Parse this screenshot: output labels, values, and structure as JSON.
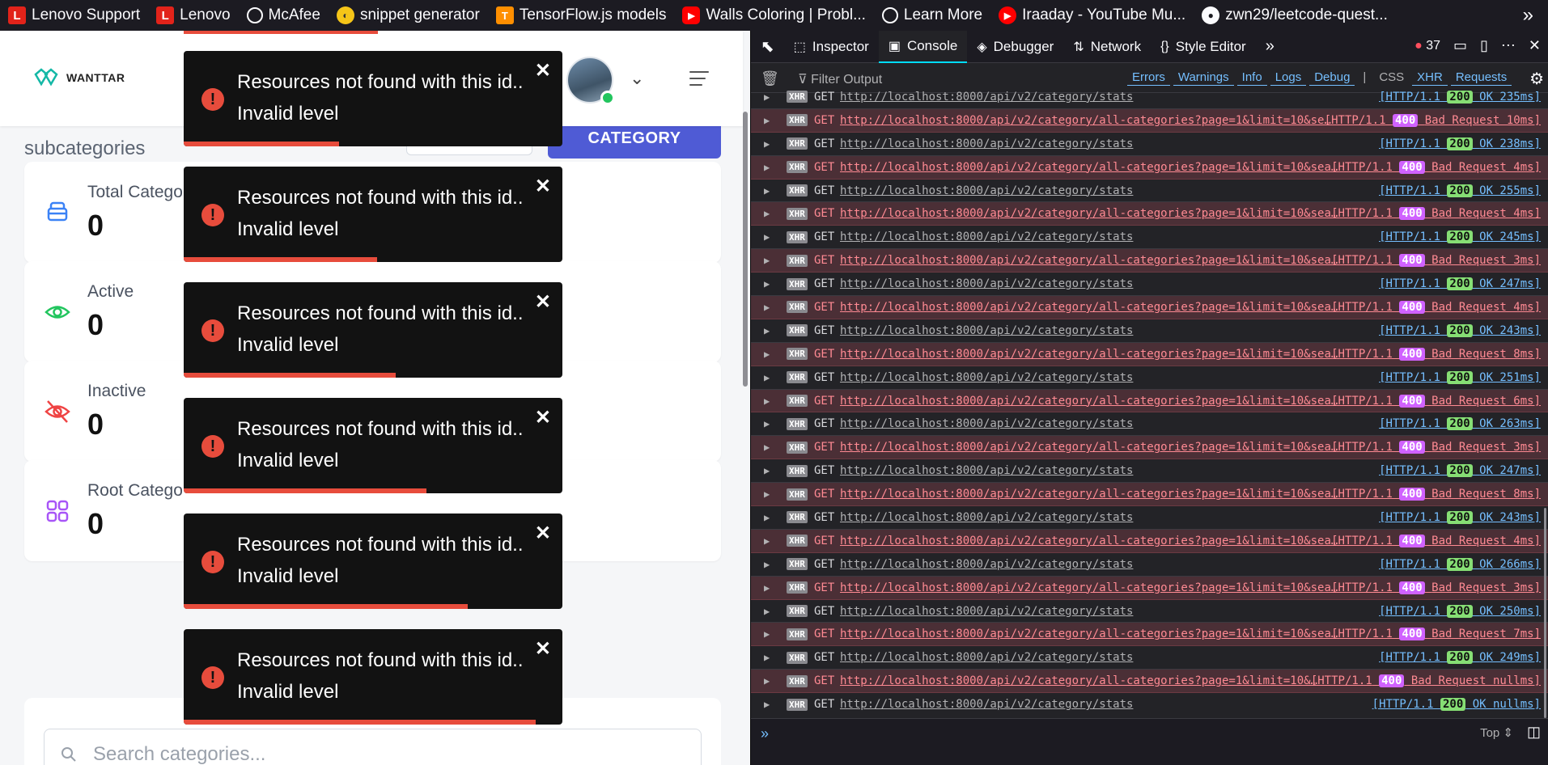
{
  "bookmarks": [
    {
      "label": "Lenovo Support",
      "icon": "lenovo-icon",
      "glyph": "L"
    },
    {
      "label": "Lenovo",
      "icon": "lenovo-icon",
      "glyph": "L"
    },
    {
      "label": "McAfee",
      "icon": "globe-icon",
      "glyph": ""
    },
    {
      "label": "snippet generator",
      "icon": "duck-icon",
      "glyph": "◐"
    },
    {
      "label": "TensorFlow.js models",
      "icon": "tensorflow-icon",
      "glyph": "T"
    },
    {
      "label": "Walls Coloring | Probl...",
      "icon": "youtube-icon",
      "glyph": "▶"
    },
    {
      "label": "Learn More",
      "icon": "globe-icon",
      "glyph": ""
    },
    {
      "label": "Iraaday - YouTube Mu...",
      "icon": "youtube-music-icon",
      "glyph": "▶"
    },
    {
      "label": "zwn29/leetcode-quest...",
      "icon": "github-icon",
      "glyph": "●"
    }
  ],
  "bookmarks_more": "»",
  "header": {
    "logo_text": "WANTTAR"
  },
  "page": {
    "subtitle": "subcategories",
    "add_button": "CATEGORY"
  },
  "cards": [
    {
      "label": "Total Catego",
      "value": "0",
      "icon": "layers-icon",
      "color": "#3b82f6"
    },
    {
      "label": "Active",
      "value": "0",
      "icon": "eye-icon",
      "color": "#22c55e"
    },
    {
      "label": "Inactive",
      "value": "0",
      "icon": "eye-off-icon",
      "color": "#ef4444"
    },
    {
      "label": "Root Catego",
      "value": "0",
      "icon": "grid-icon",
      "color": "#a855f7"
    }
  ],
  "search": {
    "placeholder": "Search categories..."
  },
  "toasts": [
    {
      "line1": "Resources not found with this id..",
      "line2": "Invalid level",
      "progress": 0.41
    },
    {
      "line1": "Resources not found with this id..",
      "line2": "Invalid level",
      "progress": 0.51
    },
    {
      "line1": "Resources not found with this id..",
      "line2": "Invalid level",
      "progress": 0.56
    },
    {
      "line1": "Resources not found with this id..",
      "line2": "Invalid level",
      "progress": 0.64
    },
    {
      "line1": "Resources not found with this id..",
      "line2": "Invalid level",
      "progress": 0.75
    },
    {
      "line1": "Resources not found with this id..",
      "line2": "Invalid level",
      "progress": 0.93
    }
  ],
  "toast_close": "✕",
  "toast_icon": "!",
  "devtools": {
    "tabs": [
      {
        "label": "Inspector",
        "icon": "inspector-icon",
        "glyph": "⬚"
      },
      {
        "label": "Console",
        "icon": "console-icon",
        "glyph": "▣"
      },
      {
        "label": "Debugger",
        "icon": "debugger-icon",
        "glyph": "◈"
      },
      {
        "label": "Network",
        "icon": "network-icon",
        "glyph": "⇅"
      },
      {
        "label": "Style Editor",
        "icon": "style-editor-icon",
        "glyph": "{}"
      }
    ],
    "active_tab": "Console",
    "error_count": "37",
    "filter_placeholder": "Filter Output",
    "filters": [
      "Errors",
      "Warnings",
      "Info",
      "Logs",
      "Debug"
    ],
    "filters_right": [
      "CSS",
      "XHR",
      "Requests"
    ],
    "context": "Top ⇕",
    "prompt": "»",
    "requests": [
      {
        "method": "GET",
        "url": "http://localhost:8000/api/v2/category/stats",
        "proto": "[HTTP/1.1",
        "code": "200",
        "status": "OK 235ms]",
        "error": false
      },
      {
        "method": "GET",
        "url": "http://localhost:8000/api/v2/category/all-categories?page=1&limit=10&se…",
        "proto": "[HTTP/1.1",
        "code": "400",
        "status": "Bad Request 10ms]",
        "error": true
      },
      {
        "method": "GET",
        "url": "http://localhost:8000/api/v2/category/stats",
        "proto": "[HTTP/1.1",
        "code": "200",
        "status": "OK 238ms]",
        "error": false
      },
      {
        "method": "GET",
        "url": "http://localhost:8000/api/v2/category/all-categories?page=1&limit=10&sea…",
        "proto": "[HTTP/1.1",
        "code": "400",
        "status": "Bad Request 4ms]",
        "error": true
      },
      {
        "method": "GET",
        "url": "http://localhost:8000/api/v2/category/stats",
        "proto": "[HTTP/1.1",
        "code": "200",
        "status": "OK 255ms]",
        "error": false
      },
      {
        "method": "GET",
        "url": "http://localhost:8000/api/v2/category/all-categories?page=1&limit=10&sea…",
        "proto": "[HTTP/1.1",
        "code": "400",
        "status": "Bad Request 4ms]",
        "error": true
      },
      {
        "method": "GET",
        "url": "http://localhost:8000/api/v2/category/stats",
        "proto": "[HTTP/1.1",
        "code": "200",
        "status": "OK 245ms]",
        "error": false
      },
      {
        "method": "GET",
        "url": "http://localhost:8000/api/v2/category/all-categories?page=1&limit=10&sea…",
        "proto": "[HTTP/1.1",
        "code": "400",
        "status": "Bad Request 3ms]",
        "error": true
      },
      {
        "method": "GET",
        "url": "http://localhost:8000/api/v2/category/stats",
        "proto": "[HTTP/1.1",
        "code": "200",
        "status": "OK 247ms]",
        "error": false
      },
      {
        "method": "GET",
        "url": "http://localhost:8000/api/v2/category/all-categories?page=1&limit=10&sea…",
        "proto": "[HTTP/1.1",
        "code": "400",
        "status": "Bad Request 4ms]",
        "error": true
      },
      {
        "method": "GET",
        "url": "http://localhost:8000/api/v2/category/stats",
        "proto": "[HTTP/1.1",
        "code": "200",
        "status": "OK 243ms]",
        "error": false
      },
      {
        "method": "GET",
        "url": "http://localhost:8000/api/v2/category/all-categories?page=1&limit=10&sea…",
        "proto": "[HTTP/1.1",
        "code": "400",
        "status": "Bad Request 8ms]",
        "error": true
      },
      {
        "method": "GET",
        "url": "http://localhost:8000/api/v2/category/stats",
        "proto": "[HTTP/1.1",
        "code": "200",
        "status": "OK 251ms]",
        "error": false
      },
      {
        "method": "GET",
        "url": "http://localhost:8000/api/v2/category/all-categories?page=1&limit=10&sea…",
        "proto": "[HTTP/1.1",
        "code": "400",
        "status": "Bad Request 6ms]",
        "error": true
      },
      {
        "method": "GET",
        "url": "http://localhost:8000/api/v2/category/stats",
        "proto": "[HTTP/1.1",
        "code": "200",
        "status": "OK 263ms]",
        "error": false
      },
      {
        "method": "GET",
        "url": "http://localhost:8000/api/v2/category/all-categories?page=1&limit=10&sea…",
        "proto": "[HTTP/1.1",
        "code": "400",
        "status": "Bad Request 3ms]",
        "error": true
      },
      {
        "method": "GET",
        "url": "http://localhost:8000/api/v2/category/stats",
        "proto": "[HTTP/1.1",
        "code": "200",
        "status": "OK 247ms]",
        "error": false
      },
      {
        "method": "GET",
        "url": "http://localhost:8000/api/v2/category/all-categories?page=1&limit=10&sea…",
        "proto": "[HTTP/1.1",
        "code": "400",
        "status": "Bad Request 8ms]",
        "error": true
      },
      {
        "method": "GET",
        "url": "http://localhost:8000/api/v2/category/stats",
        "proto": "[HTTP/1.1",
        "code": "200",
        "status": "OK 243ms]",
        "error": false
      },
      {
        "method": "GET",
        "url": "http://localhost:8000/api/v2/category/all-categories?page=1&limit=10&sea…",
        "proto": "[HTTP/1.1",
        "code": "400",
        "status": "Bad Request 4ms]",
        "error": true
      },
      {
        "method": "GET",
        "url": "http://localhost:8000/api/v2/category/stats",
        "proto": "[HTTP/1.1",
        "code": "200",
        "status": "OK 266ms]",
        "error": false
      },
      {
        "method": "GET",
        "url": "http://localhost:8000/api/v2/category/all-categories?page=1&limit=10&sea…",
        "proto": "[HTTP/1.1",
        "code": "400",
        "status": "Bad Request 3ms]",
        "error": true
      },
      {
        "method": "GET",
        "url": "http://localhost:8000/api/v2/category/stats",
        "proto": "[HTTP/1.1",
        "code": "200",
        "status": "OK 250ms]",
        "error": false
      },
      {
        "method": "GET",
        "url": "http://localhost:8000/api/v2/category/all-categories?page=1&limit=10&sea…",
        "proto": "[HTTP/1.1",
        "code": "400",
        "status": "Bad Request 7ms]",
        "error": true
      },
      {
        "method": "GET",
        "url": "http://localhost:8000/api/v2/category/stats",
        "proto": "[HTTP/1.1",
        "code": "200",
        "status": "OK 249ms]",
        "error": false
      },
      {
        "method": "GET",
        "url": "http://localhost:8000/api/v2/category/all-categories?page=1&limit=10&…",
        "proto": "[HTTP/1.1",
        "code": "400",
        "status": "Bad Request nullms]",
        "error": true
      },
      {
        "method": "GET",
        "url": "http://localhost:8000/api/v2/category/stats",
        "proto": "[HTTP/1.1",
        "code": "200",
        "status": "OK nullms]",
        "error": false
      }
    ]
  }
}
